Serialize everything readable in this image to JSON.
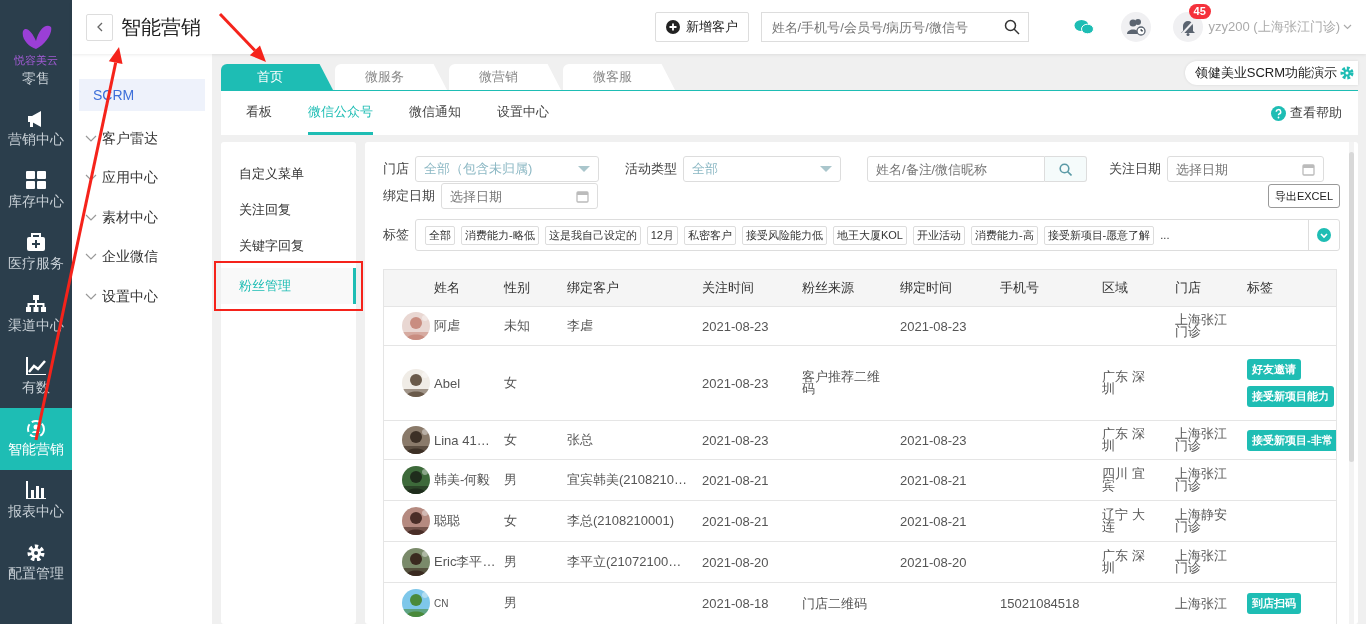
{
  "logo": {
    "text": "悦容美云"
  },
  "nav": {
    "items": [
      {
        "label": "零售",
        "kind": "label-only",
        "selected": false
      },
      {
        "label": "营销中心",
        "kind": "icon",
        "selected": false
      },
      {
        "label": "库存中心",
        "kind": "icon",
        "selected": false
      },
      {
        "label": "医疗服务",
        "kind": "icon",
        "selected": false
      },
      {
        "label": "渠道中心",
        "kind": "icon",
        "selected": false
      },
      {
        "label": "有数",
        "kind": "icon",
        "selected": false
      },
      {
        "label": "智能营销",
        "kind": "icon",
        "selected": true
      },
      {
        "label": "报表中心",
        "kind": "icon",
        "selected": false
      },
      {
        "label": "配置管理",
        "kind": "icon",
        "selected": false
      }
    ]
  },
  "header": {
    "title": "智能营销",
    "add_button": "新增客户",
    "search": {
      "placeholder": "姓名/手机号/会员号/病历号/微信号"
    },
    "notification_count": "45",
    "user": "yzy200 (上海张江门诊)"
  },
  "sidebar": {
    "items": [
      {
        "label": "SCRM",
        "selected": true,
        "expandable": false
      },
      {
        "label": "客户雷达",
        "selected": false,
        "expandable": true
      },
      {
        "label": "应用中心",
        "selected": false,
        "expandable": true
      },
      {
        "label": "素材中心",
        "selected": false,
        "expandable": true
      },
      {
        "label": "企业微信",
        "selected": false,
        "expandable": true
      },
      {
        "label": "设置中心",
        "selected": false,
        "expandable": true
      }
    ]
  },
  "tabs": [
    {
      "label": "首页",
      "selected": true
    },
    {
      "label": "微服务",
      "selected": false
    },
    {
      "label": "微营销",
      "selected": false
    },
    {
      "label": "微客服",
      "selected": false
    }
  ],
  "account_chip": "领健美业SCRM功能演示",
  "subtabs": [
    {
      "label": "看板",
      "selected": false
    },
    {
      "label": "微信公众号",
      "selected": true
    },
    {
      "label": "微信通知",
      "selected": false
    },
    {
      "label": "设置中心",
      "selected": false
    }
  ],
  "help_link": "查看帮助",
  "submenu": {
    "items": [
      {
        "label": "自定义菜单",
        "selected": false,
        "highlighted": false
      },
      {
        "label": "关注回复",
        "selected": false,
        "highlighted": false
      },
      {
        "label": "关键字回复",
        "selected": false,
        "highlighted": false
      },
      {
        "label": "粉丝管理",
        "selected": true,
        "highlighted": true
      }
    ]
  },
  "filters": {
    "store": {
      "label": "门店",
      "value": "全部（包含未归属)"
    },
    "activity_type": {
      "label": "活动类型",
      "value": "全部"
    },
    "keyword": {
      "placeholder": "姓名/备注/微信昵称"
    },
    "follow_date": {
      "label": "关注日期",
      "placeholder": "选择日期"
    },
    "bind_date": {
      "label": "绑定日期",
      "placeholder": "选择日期"
    },
    "export_button": "导出EXCEL",
    "tags_label": "标签",
    "tags": [
      "全部",
      "消费能力-略低",
      "这是我自己设定的",
      "12月",
      "私密客户",
      "接受风险能力低",
      "地王大厦KOL",
      "开业活动",
      "消费能力-高",
      "接受新项目-愿意了解"
    ],
    "tags_more": "..."
  },
  "table": {
    "columns": [
      "姓名",
      "性别",
      "绑定客户",
      "关注时间",
      "粉丝来源",
      "绑定时间",
      "手机号",
      "区域",
      "门店",
      "标签"
    ],
    "rows": [
      {
        "cells": [
          "阿虐",
          "未知",
          "李虐",
          "2021-08-23",
          "",
          "2021-08-23",
          "",
          "",
          "上海张江门诊"
        ],
        "tags": []
      },
      {
        "cells": [
          "Abel",
          "女",
          "",
          "2021-08-23",
          "客户推荐二维码",
          "",
          "",
          "广东 深圳",
          ""
        ],
        "tags": [
          "好友邀请",
          "接受新项目能力"
        ]
      },
      {
        "cells": [
          "Lina 41…",
          "女",
          "张总",
          "2021-08-23",
          "",
          "2021-08-23",
          "",
          "广东 深圳",
          "上海张江门诊"
        ],
        "tags": [
          "接受新项目-非常"
        ]
      },
      {
        "cells": [
          "韩美-何毅",
          "男",
          "宜宾韩美(2108210…",
          "2021-08-21",
          "",
          "2021-08-21",
          "",
          "四川 宜宾",
          "上海张江门诊"
        ],
        "tags": []
      },
      {
        "cells": [
          "聪聪",
          "女",
          "李总(2108210001)",
          "2021-08-21",
          "",
          "2021-08-21",
          "",
          "辽宁 大连",
          "上海静安门诊"
        ],
        "tags": []
      },
      {
        "cells": [
          "Eric李平…",
          "男",
          "李平立(21072100…",
          "2021-08-20",
          "",
          "2021-08-20",
          "",
          "广东 深圳",
          "上海张江门诊"
        ],
        "tags": []
      },
      {
        "cells": [
          "CN",
          "男",
          "",
          "2021-08-18",
          "门店二维码",
          "",
          "15021084518",
          "",
          "上海张江"
        ],
        "tags": [
          "到店扫码"
        ]
      }
    ]
  },
  "annotations": [
    {
      "kind": "arrow"
    },
    {
      "kind": "arrow"
    }
  ]
}
